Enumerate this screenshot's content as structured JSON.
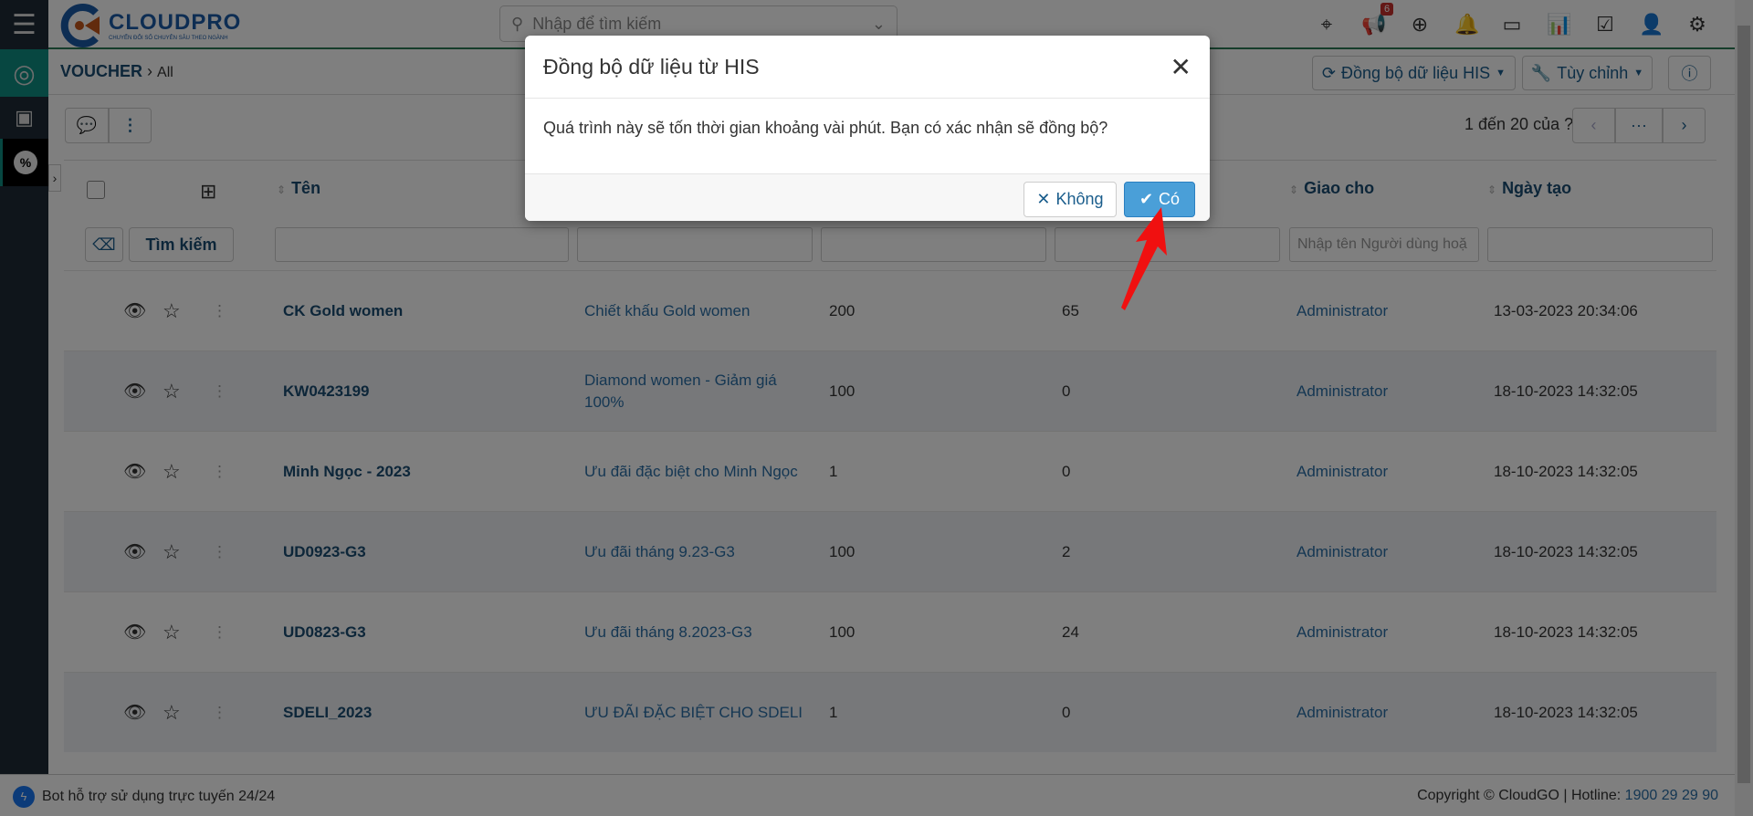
{
  "app": {
    "logo_text": "CLOUDPRO",
    "logo_tagline": "CHUYỂN ĐỔI SỐ CHUYÊN SÂU THEO NGÀNH"
  },
  "search": {
    "placeholder": "Nhập để tìm kiếm"
  },
  "topbar": {
    "notification_count": "6",
    "icons": [
      "map-pin-icon",
      "megaphone-icon",
      "plus-circle-icon",
      "bell-icon",
      "calendar-icon",
      "chart-icon",
      "checkbox-icon",
      "user-icon",
      "gear-icon"
    ]
  },
  "breadcrumb": {
    "module": "VOUCHER",
    "view": "All"
  },
  "actions": {
    "sync_label": "Đồng bộ dữ liệu HIS",
    "customize_label": "Tùy chỉnh"
  },
  "pagination": {
    "text": "1 đến 20 của",
    "total": "?",
    "more": "···"
  },
  "table": {
    "headers": [
      "Tên",
      "",
      "",
      "",
      "Giao cho",
      "Ngày tạo"
    ],
    "search_button": "Tìm kiếm",
    "filter_placeholder_assignee": "Nhập tên Người dùng hoặ",
    "rows": [
      {
        "name": "CK Gold women",
        "desc": "Chiết khấu Gold women",
        "c3": "200",
        "c4": "65",
        "assignee": "Administrator",
        "created": "13-03-2023 20:34:06"
      },
      {
        "name": "KW0423199",
        "desc": "Diamond women - Giảm giá 100%",
        "c3": "100",
        "c4": "0",
        "assignee": "Administrator",
        "created": "18-10-2023 14:32:05"
      },
      {
        "name": "Minh Ngọc - 2023",
        "desc": "Ưu đãi đặc biệt cho Minh Ngọc",
        "c3": "1",
        "c4": "0",
        "assignee": "Administrator",
        "created": "18-10-2023 14:32:05"
      },
      {
        "name": "UD0923-G3",
        "desc": "Ưu đãi tháng 9.23-G3",
        "c3": "100",
        "c4": "2",
        "assignee": "Administrator",
        "created": "18-10-2023 14:32:05"
      },
      {
        "name": "UD0823-G3",
        "desc": "Ưu đãi tháng 8.2023-G3",
        "c3": "100",
        "c4": "24",
        "assignee": "Administrator",
        "created": "18-10-2023 14:32:05"
      },
      {
        "name": "SDELI_2023",
        "desc": "ƯU ĐÃI ĐẶC BIỆT CHO SDELI",
        "c3": "1",
        "c4": "0",
        "assignee": "Administrator",
        "created": "18-10-2023 14:32:05"
      }
    ]
  },
  "footer": {
    "bot": "Bot hỗ trợ sử dụng trực tuyến 24/24",
    "copyright": "Copyright © CloudGO",
    "hotline_label": "Hotline:",
    "hotline": "1900 29 29 90"
  },
  "modal": {
    "title": "Đồng bộ dữ liệu từ HIS",
    "message": "Quá trình này sẽ tốn thời gian khoảng vài phút. Bạn có xác nhận sẽ đồng bộ?",
    "cancel": "Không",
    "confirm": "Có"
  },
  "colors": {
    "primary": "#1a4d73",
    "confirm": "#4a9fd8",
    "badge": "#c9302c",
    "sidebar": "#1f2a36",
    "active": "#0e8f82"
  }
}
